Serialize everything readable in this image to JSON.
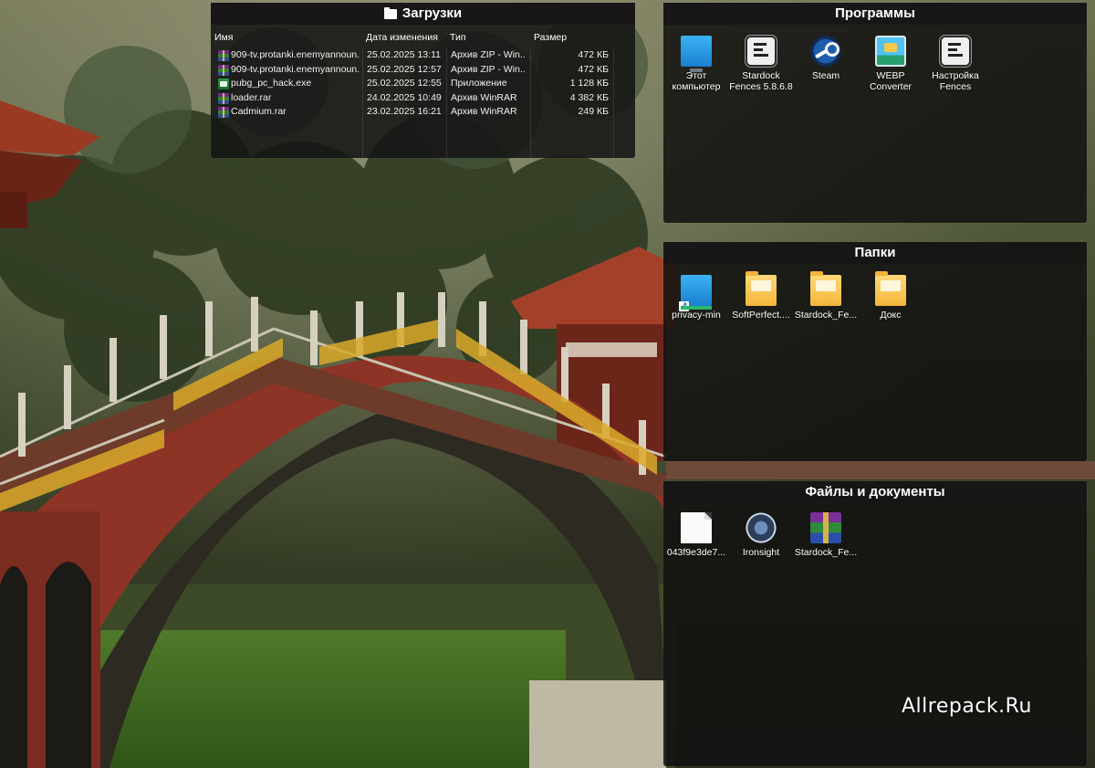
{
  "downloads": {
    "title": "Загрузки",
    "columns": [
      "Имя",
      "Дата изменения",
      "Тип",
      "Размер"
    ],
    "rows": [
      {
        "name": "909-tv.protanki.enemyannoun...",
        "date": "25.02.2025 13:11",
        "type": "Архив ZIP - Win...",
        "size": "472 КБ",
        "icon": "winrar-archive-icon"
      },
      {
        "name": "909-tv.protanki.enemyannoun...",
        "date": "25.02.2025 12:57",
        "type": "Архив ZIP - Win...",
        "size": "472 КБ",
        "icon": "winrar-archive-icon"
      },
      {
        "name": "pubg_pc_hack.exe",
        "date": "25.02.2025 12:55",
        "type": "Приложение",
        "size": "1 128 КБ",
        "icon": "application-exe-icon"
      },
      {
        "name": "loader.rar",
        "date": "24.02.2025 10:49",
        "type": "Архив WinRAR",
        "size": "4 382 КБ",
        "icon": "winrar-archive-icon"
      },
      {
        "name": "Cadmium.rar",
        "date": "23.02.2025 16:21",
        "type": "Архив WinRAR",
        "size": "249 КБ",
        "icon": "winrar-archive-icon"
      }
    ]
  },
  "programs": {
    "title": "Программы",
    "items": [
      {
        "label": "Этот компьютер",
        "icon": "this-pc-icon"
      },
      {
        "label": "Stardock Fences 5.8.6.8",
        "icon": "fences-icon"
      },
      {
        "label": "Steam",
        "icon": "steam-icon"
      },
      {
        "label": "WEBP Converter",
        "icon": "webp-converter-icon"
      },
      {
        "label": "Настройка Fences",
        "icon": "fences-settings-icon"
      }
    ]
  },
  "folders": {
    "title": "Папки",
    "items": [
      {
        "label": "privacy-min",
        "icon": "shortcut-icon"
      },
      {
        "label": "SoftPerfect....",
        "icon": "folder-icon"
      },
      {
        "label": "Stardock_Fe...",
        "icon": "folder-icon"
      },
      {
        "label": "Докс",
        "icon": "folder-icon"
      }
    ]
  },
  "docs": {
    "title": "Файлы и документы",
    "items": [
      {
        "label": "043f9e3de7...",
        "icon": "file-icon"
      },
      {
        "label": "Ironsight",
        "icon": "ironsight-icon"
      },
      {
        "label": "Stardock_Fe...",
        "icon": "winrar-icon"
      }
    ]
  },
  "watermark": "Allrepack.Ru"
}
